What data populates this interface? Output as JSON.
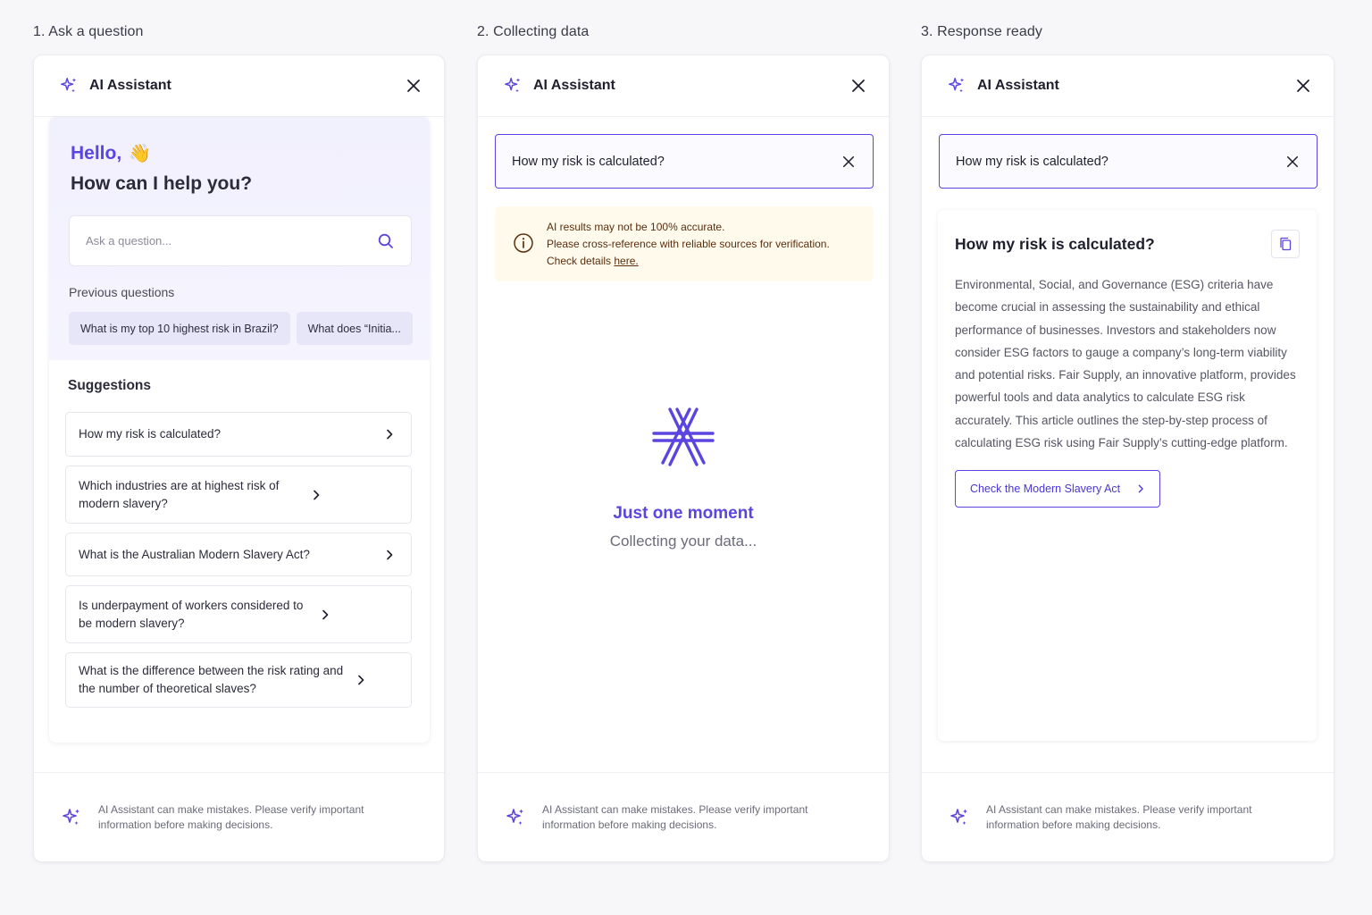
{
  "steps": [
    "1. Ask a question",
    "2. Collecting data",
    "3. Response ready"
  ],
  "assistant_title": "AI Assistant",
  "footer_note": "AI Assistant can make mistakes. Please verify important information before making decisions.",
  "colors": {
    "accent": "#5b45e0",
    "warning_bg": "#fffaec",
    "warning_text": "#5a2e0e"
  },
  "icons": [
    "sparkle-icon",
    "close-icon",
    "search-icon",
    "chevron-right-icon",
    "info-icon",
    "loader-icon",
    "copy-icon"
  ],
  "panel1": {
    "hello": "Hello,",
    "wave": "👋",
    "help": "How can I help you?",
    "search_placeholder": "Ask a question...",
    "previous_label": "Previous questions",
    "previous": [
      "What is my top 10 highest risk in Brazil?",
      "What does “Initia..."
    ],
    "suggestions_title": "Suggestions",
    "suggestions": [
      "How my risk is calculated?",
      "Which industries are at highest risk of modern slavery?",
      "What is the Australian Modern Slavery Act?",
      "Is underpayment of workers considered to be modern slavery?",
      "What is the difference between the risk rating and the number of theoretical slaves?"
    ]
  },
  "panel2": {
    "query": "How my risk is calculated?",
    "warning_line1": "AI results may not be 100% accurate.",
    "warning_line2": "Please cross-reference with reliable sources for verification.",
    "warning_line3": "Check details ",
    "warning_link": "here.",
    "loading_title": "Just one moment",
    "loading_sub": "Collecting your data..."
  },
  "panel3": {
    "query": "How my risk is calculated?",
    "answer_title": "How my risk is calculated?",
    "answer_body": "Environmental, Social, and Governance (ESG) criteria have become crucial in assessing the sustainability and ethical performance of businesses. Investors and stakeholders now consider ESG factors to gauge a company’s long-term viability and potential risks. Fair Supply, an innovative platform, provides powerful tools and data analytics to calculate ESG risk accurately. This article outlines the step-by-step process of calculating ESG risk using Fair Supply’s cutting-edge platform.",
    "link_label": "Check the Modern Slavery Act"
  }
}
